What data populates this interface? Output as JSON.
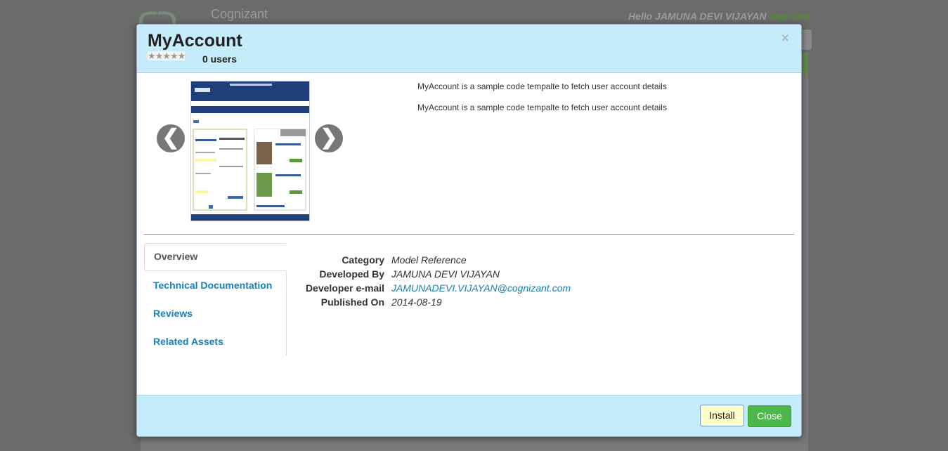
{
  "background": {
    "logo_text": "Cognizant",
    "greeting": "Hello JAMUNA DEVI VIJAYAN",
    "sign_out": "Sign Out"
  },
  "modal": {
    "title": "MyAccount",
    "rating_stars": "★★★★★",
    "users": "0 users",
    "close_symbol": "×",
    "carousel_prev": "❮",
    "carousel_next": "❯",
    "descriptions": [
      "MyAccount is a sample code tempalte to fetch user account details",
      "MyAccount is a sample code tempalte to fetch user account details"
    ],
    "tabs": [
      {
        "label": "Overview",
        "active": true
      },
      {
        "label": "Technical Documentation",
        "active": false
      },
      {
        "label": "Reviews",
        "active": false
      },
      {
        "label": "Related Assets",
        "active": false
      }
    ],
    "details": {
      "category_label": "Category",
      "category_value": "Model Reference",
      "developed_by_label": "Developed By",
      "developed_by_value": "JAMUNA DEVI VIJAYAN",
      "email_label": "Developer e-mail",
      "email_value": "JAMUNADEVI.VIJAYAN@cognizant.com",
      "published_label": "Published On",
      "published_value": "2014-08-19"
    },
    "footer": {
      "install": "Install",
      "close": "Close"
    }
  },
  "colors": {
    "header_bg": "#c5ecfb",
    "link": "#1a7fb5",
    "close_button": "#4cb84c",
    "install_button": "#ffffcc"
  }
}
